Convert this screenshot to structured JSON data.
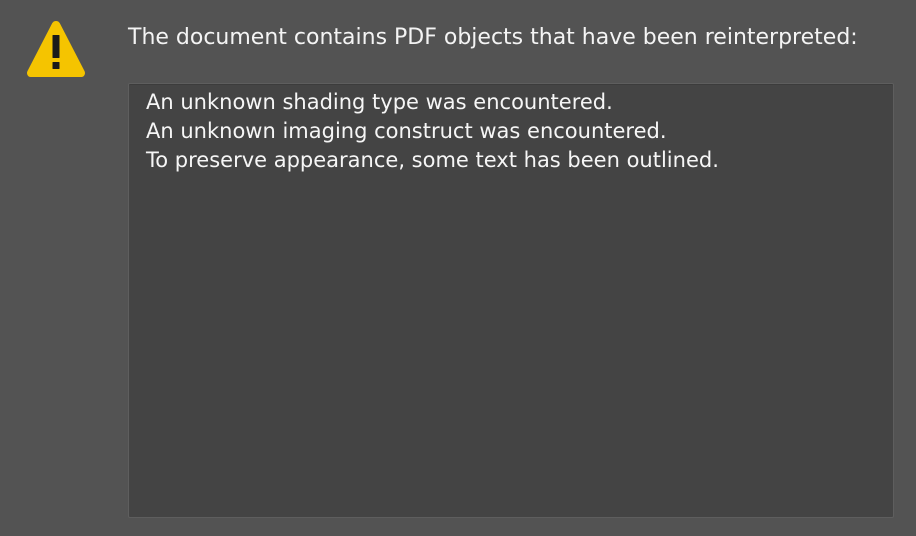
{
  "dialog": {
    "icon": "warning-icon",
    "icon_color": "#F5C400",
    "message": "The document contains PDF objects that have been reinterpreted:",
    "details": [
      "An unknown shading type was encountered.",
      "An unknown imaging construct was encountered.",
      "To preserve appearance, some text has been outlined."
    ]
  },
  "colors": {
    "background": "#535353",
    "details_background": "#444444",
    "text": "#FFFFFF"
  }
}
